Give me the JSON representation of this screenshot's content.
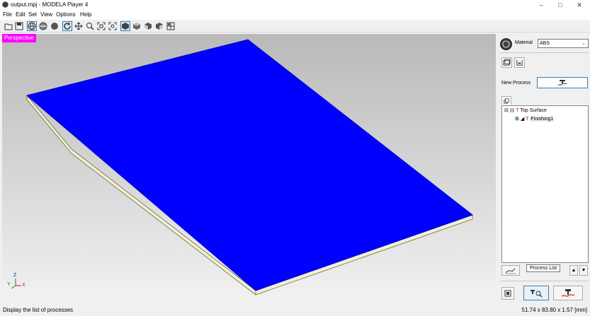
{
  "window": {
    "title": "output.mpj - MODELA Player 4",
    "minimize": "–",
    "maximize": "□",
    "close": "✕"
  },
  "menu": [
    "File",
    "Edit",
    "Set",
    "View",
    "Options",
    "Help"
  ],
  "toolbar": {
    "buttons": [
      {
        "name": "new-file-icon",
        "active": false
      },
      {
        "name": "save-icon",
        "active": false
      },
      {
        "name": "wireframe-globe-icon",
        "active": true
      },
      {
        "name": "shaded-globe-icon",
        "active": false
      },
      {
        "name": "sphere-icon",
        "active": false
      },
      {
        "name": "rotate-icon",
        "active": true
      },
      {
        "name": "pan-icon",
        "active": false
      },
      {
        "name": "zoom-icon",
        "active": false
      },
      {
        "name": "zoom-fit-icon",
        "active": false
      },
      {
        "name": "zoom-window-icon",
        "active": false
      },
      {
        "name": "view-perspective-icon",
        "active": true
      },
      {
        "name": "view-top-icon",
        "active": false
      },
      {
        "name": "view-front-icon",
        "active": false
      },
      {
        "name": "view-side-icon",
        "active": false
      },
      {
        "name": "view-multi-icon",
        "active": false
      }
    ]
  },
  "viewport": {
    "label": "Perspective",
    "plate_color": "#0000ff",
    "background_top": "#b9b9b9",
    "axis_labels": {
      "z": "Z",
      "y": "Y",
      "x": "X"
    }
  },
  "panel": {
    "material_label": "Material",
    "material_value": "ABS",
    "new_process_label": "New Process",
    "tree": [
      {
        "label": "Top Surface",
        "expander": "⊟"
      },
      {
        "label": "Finishing1",
        "expander": "⊞"
      }
    ],
    "tooltip": "Process List"
  },
  "status": {
    "message": "Display the list of processes",
    "dimensions": "51.74 x 83.80 x 1.57 [mm]"
  }
}
